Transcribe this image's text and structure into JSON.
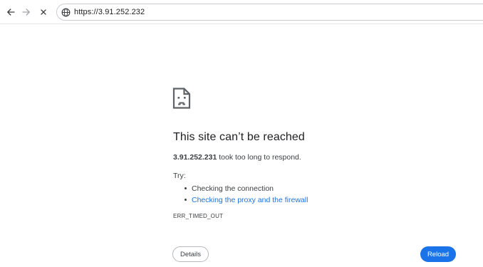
{
  "toolbar": {
    "back_icon": "arrow-left-icon",
    "forward_icon": "arrow-right-icon",
    "stop_icon": "close-icon",
    "site_info_icon": "globe-icon",
    "url": "https://3.91.252.232"
  },
  "error": {
    "icon": "sad-document-icon",
    "title": "This site can’t be reached",
    "host": "3.91.252.231",
    "message": " took too long to respond.",
    "try_label": "Try:",
    "suggestions": [
      {
        "label": "Checking the connection",
        "is_link": false
      },
      {
        "label": "Checking the proxy and the firewall",
        "is_link": true
      }
    ],
    "code": "ERR_TIMED_OUT"
  },
  "buttons": {
    "details_label": "Details",
    "reload_label": "Reload"
  },
  "colors": {
    "accent": "#1a73e8",
    "text": "#202124",
    "secondary_text": "#3c4043"
  }
}
